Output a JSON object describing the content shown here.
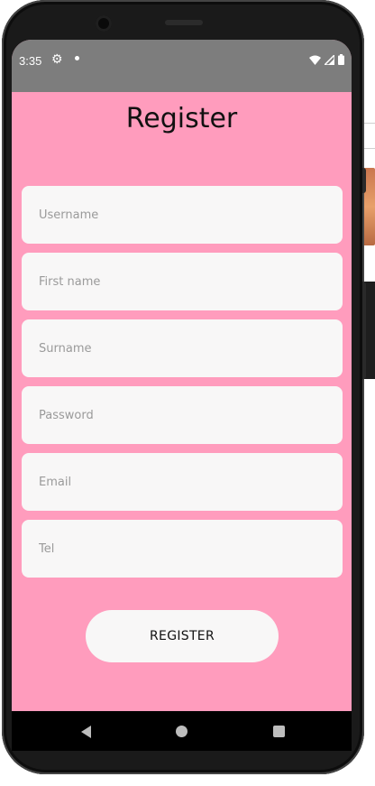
{
  "status_bar": {
    "time": "3:35",
    "icons": [
      "gear-icon",
      "notification-dot",
      "wifi-icon",
      "signal-icon",
      "battery-icon"
    ]
  },
  "app": {
    "title": "Register",
    "background_color": "#ff9cbd",
    "fields": {
      "username": {
        "placeholder": "Username",
        "value": ""
      },
      "first_name": {
        "placeholder": "First name",
        "value": ""
      },
      "surname": {
        "placeholder": "Surname",
        "value": ""
      },
      "password": {
        "placeholder": "Password",
        "value": ""
      },
      "email": {
        "placeholder": "Email",
        "value": ""
      },
      "tel": {
        "placeholder": "Tel",
        "value": ""
      }
    },
    "register_button": "REGISTER"
  },
  "nav_bar": {
    "buttons": [
      "back-icon",
      "home-icon",
      "recents-icon"
    ]
  }
}
